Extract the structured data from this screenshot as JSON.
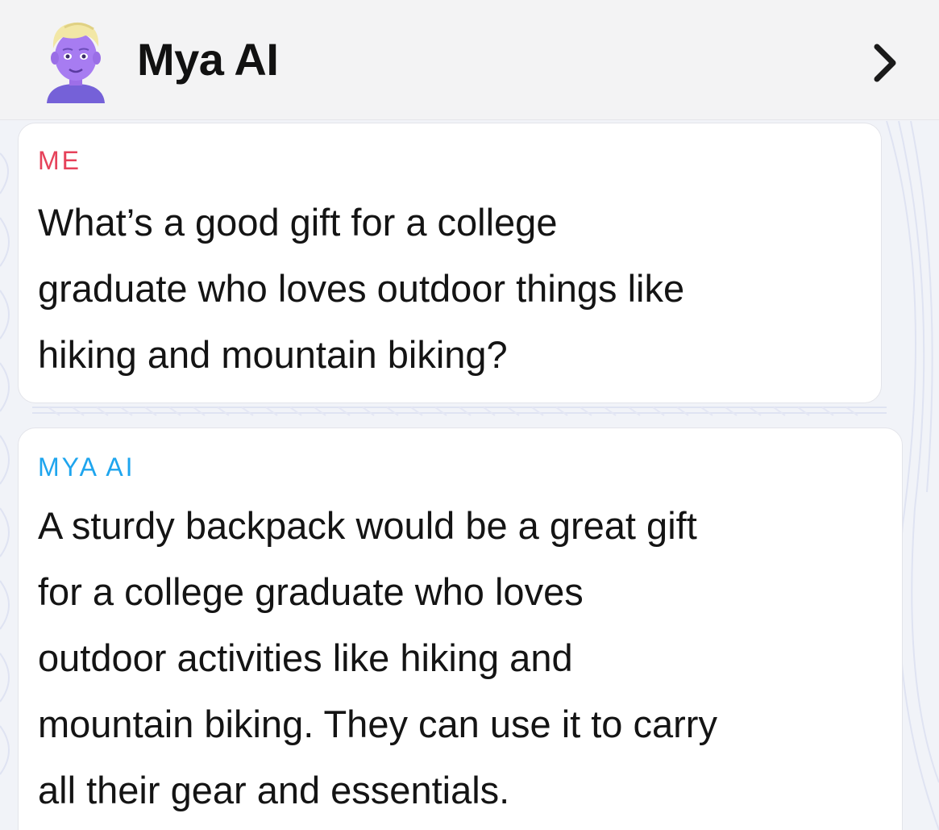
{
  "header": {
    "title": "Mya AI",
    "avatar_icon": "bitmoji-avatar-icon",
    "chevron_icon": "chevron-right-icon"
  },
  "messages": [
    {
      "sender": "ME",
      "sender_color": "#e6425a",
      "lines": [
        "What’s a good gift for a college",
        "graduate who loves outdoor things like",
        "hiking and mountain biking?"
      ]
    },
    {
      "sender": "MYA AI",
      "sender_color": "#1ea5ee",
      "lines": [
        "A sturdy backpack would be a great gift",
        "for a college graduate who loves",
        "outdoor activities like hiking and",
        "mountain biking. They can use it to carry",
        "all their gear and essentials."
      ]
    }
  ]
}
